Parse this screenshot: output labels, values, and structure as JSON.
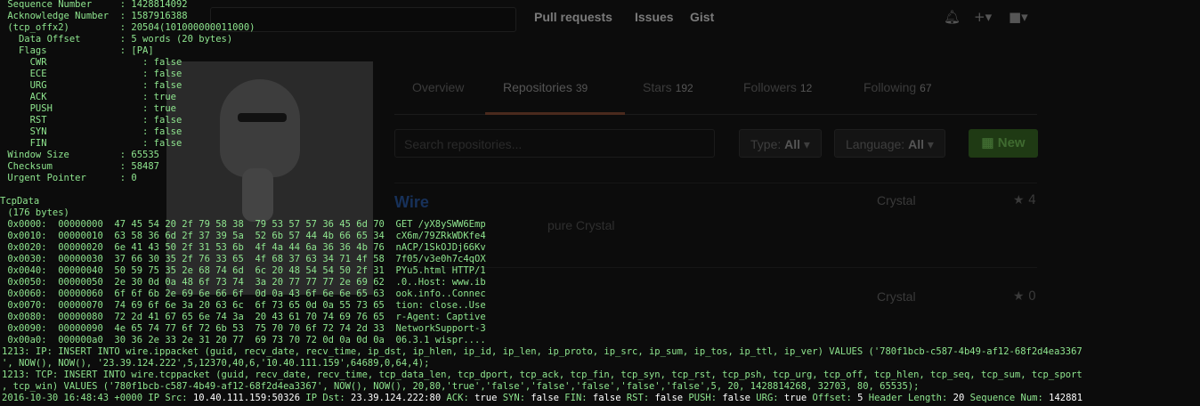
{
  "github": {
    "nav": [
      "Pull requests",
      "Issues",
      "Gist"
    ],
    "icons": [
      "bell-icon",
      "plus-icon",
      "avatar-menu-icon"
    ],
    "tabs": [
      {
        "label": "Overview",
        "count": ""
      },
      {
        "label": "Repositories",
        "count": "39"
      },
      {
        "label": "Stars",
        "count": "192"
      },
      {
        "label": "Followers",
        "count": "12"
      },
      {
        "label": "Following",
        "count": "67"
      }
    ],
    "search_placeholder": "Search repositories...",
    "type_filter": {
      "label": "Type:",
      "value": "All"
    },
    "language_filter": {
      "label": "Language:",
      "value": "All"
    },
    "new_button": "New",
    "repos": [
      {
        "name": "Wire",
        "desc": "pure Crystal",
        "lang": "Crystal",
        "stars": "4"
      },
      {
        "name": "",
        "desc": "",
        "lang": "Crystal",
        "stars": "0"
      }
    ]
  },
  "terminal": {
    "tcp_fields": [
      " Sequence Number     : 1428814092",
      " Acknowledge Number  : 1587916388",
      " (tcp_offx2)         : 20504(101000000011000)",
      "   Data Offset       : 5 words (20 bytes)",
      "   Flags             : [PA]",
      "     CWR                 : false",
      "     ECE                 : false",
      "     URG                 : false",
      "     ACK                 : true",
      "     PUSH                : true",
      "     RST                 : false",
      "     SYN                 : false",
      "     FIN                 : false",
      " Window Size         : 65535",
      " Checksum            : 58487",
      " Urgent Pointer      : 0"
    ],
    "tcpdata_header": "TcpData",
    "tcpdata_size": " (176 bytes)",
    "hexdump": [
      " 0x0000:  00000000  47 45 54 20 2f 79 58 38  79 53 57 57 36 45 6d 70  GET /yX8ySWW6Emp",
      " 0x0010:  00000010  63 58 36 6d 2f 37 39 5a  52 6b 57 44 4b 66 65 34  cX6m/79ZRkWDKfe4",
      " 0x0020:  00000020  6e 41 43 50 2f 31 53 6b  4f 4a 44 6a 36 36 4b 76  nACP/1SkOJDj66Kv",
      " 0x0030:  00000030  37 66 30 35 2f 76 33 65  4f 68 37 63 34 71 4f 58  7f05/v3e0h7c4qOX",
      " 0x0040:  00000040  50 59 75 35 2e 68 74 6d  6c 20 48 54 54 50 2f 31  PYu5.html HTTP/1",
      " 0x0050:  00000050  2e 30 0d 0a 48 6f 73 74  3a 20 77 77 77 2e 69 62  .0..Host: www.ib",
      " 0x0060:  00000060  6f 6f 6b 2e 69 6e 66 6f  0d 0a 43 6f 6e 6e 65 63  ook.info..Connec",
      " 0x0070:  00000070  74 69 6f 6e 3a 20 63 6c  6f 73 65 0d 0a 55 73 65  tion: close..Use",
      " 0x0080:  00000080  72 2d 41 67 65 6e 74 3a  20 43 61 70 74 69 76 65  r-Agent: Captive",
      " 0x0090:  00000090  4e 65 74 77 6f 72 6b 53  75 70 70 6f 72 74 2d 33  NetworkSupport-3",
      " 0x00a0:  000000a0  30 36 2e 33 2e 31 20 77  69 73 70 72 0d 0a 0d 0a  06.3.1 wispr...."
    ],
    "sql_lines": [
      "1213: IP: INSERT INTO wire.ippacket (guid, recv_date, recv_time, ip_dst, ip_hlen, ip_id, ip_len, ip_proto, ip_src, ip_sum, ip_tos, ip_ttl, ip_ver) VALUES ('780f1bcb-c587-4b49-af12-68f2d4ea3367",
      "', NOW(), NOW(), '23.39.124.222',5,12370,40,6,'10.40.111.159',64689,0,64,4);",
      "1213: TCP: INSERT INTO wire.tcppacket (guid, recv_date, recv_time, tcp_data_len, tcp_dport, tcp_ack, tcp_fin, tcp_syn, tcp_rst, tcp_psh, tcp_urg, tcp_off, tcp_hlen, tcp_seq, tcp_sum, tcp_sport",
      ", tcp_win) VALUES ('780f1bcb-c587-4b49-af12-68f2d4ea3367', NOW(), NOW(), 20,80,'true','false','false','false','false','false',5, 20, 1428814268, 32703, 80, 65535);"
    ],
    "status_line": {
      "timestamp": "2016-10-30 16:48:43 +0000",
      "ip_src_label": "IP Src:",
      "ip_src": "10.40.111.159:50326",
      "ip_dst_label": "IP Dst:",
      "ip_dst": "23.39.124.222:80",
      "ack_label": "ACK:",
      "ack": "true",
      "syn_label": "SYN:",
      "syn": "false",
      "fin_label": "FIN:",
      "fin": "false",
      "rst_label": "RST:",
      "rst": "false",
      "push_label": "PUSH:",
      "push": "false",
      "urg_label": "URG:",
      "urg": "true",
      "offset_label": "Offset:",
      "offset": "5",
      "hlen_label": "Header Length:",
      "hlen": "20",
      "seq_label": "Sequence Num:",
      "seq": "142881"
    }
  }
}
